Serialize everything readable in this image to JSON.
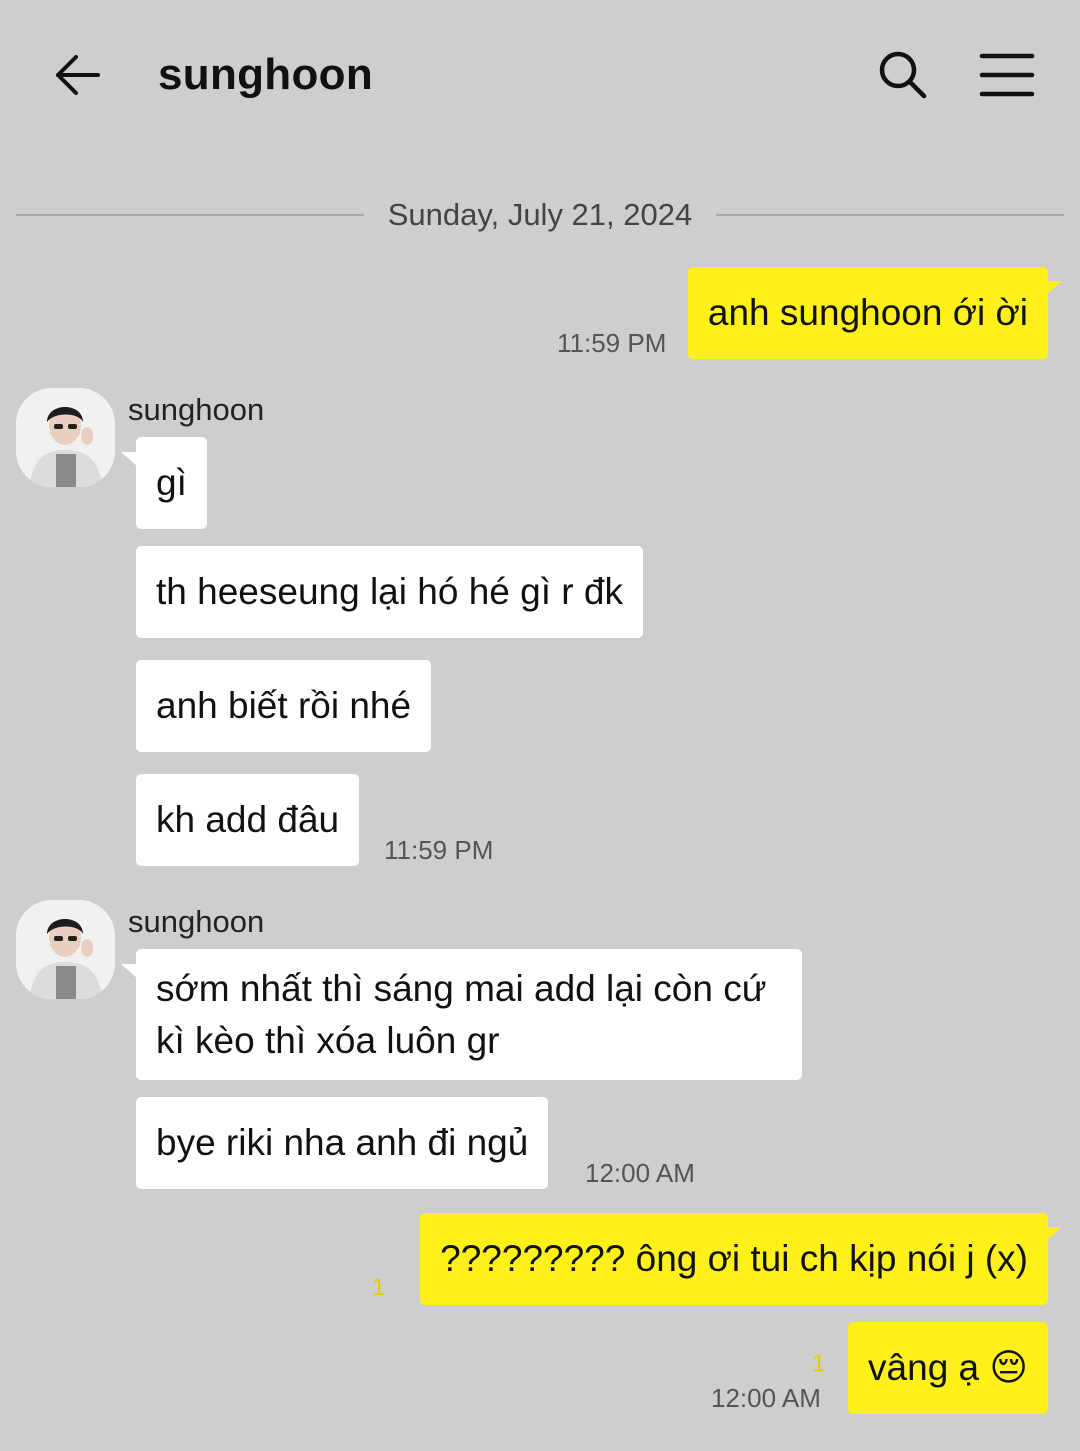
{
  "header": {
    "title": "sunghoon",
    "back_icon": "arrow-left-icon",
    "search_icon": "search-icon",
    "menu_icon": "hamburger-menu-icon"
  },
  "date_divider": "Sunday, July 21, 2024",
  "colors": {
    "background": "#cecece",
    "outgoing_bubble": "#fef01b",
    "incoming_bubble": "#ffffff",
    "unread_count": "#e6cb00"
  },
  "messages": {
    "m1": {
      "text": "anh sunghoon ới ời",
      "time": "11:59 PM"
    },
    "group1": {
      "sender": "sunghoon",
      "m1": "gì",
      "m2": "th heeseung lại hó hé gì r đk",
      "m3": "anh biết rồi nhé",
      "m4": "kh add đâu",
      "time": "11:59 PM"
    },
    "group2": {
      "sender": "sunghoon",
      "m1": "sớm nhất thì sáng mai add lại còn cứ kì kèo thì xóa luôn gr",
      "m2": "bye riki nha anh đi ngủ",
      "time": "12:00 AM"
    },
    "m2": {
      "text": "????????? ông ơi tui ch kịp nói j (x)",
      "unread": "1"
    },
    "m3": {
      "text": "vâng ạ 😔",
      "unread": "1",
      "time": "12:00 AM"
    }
  }
}
